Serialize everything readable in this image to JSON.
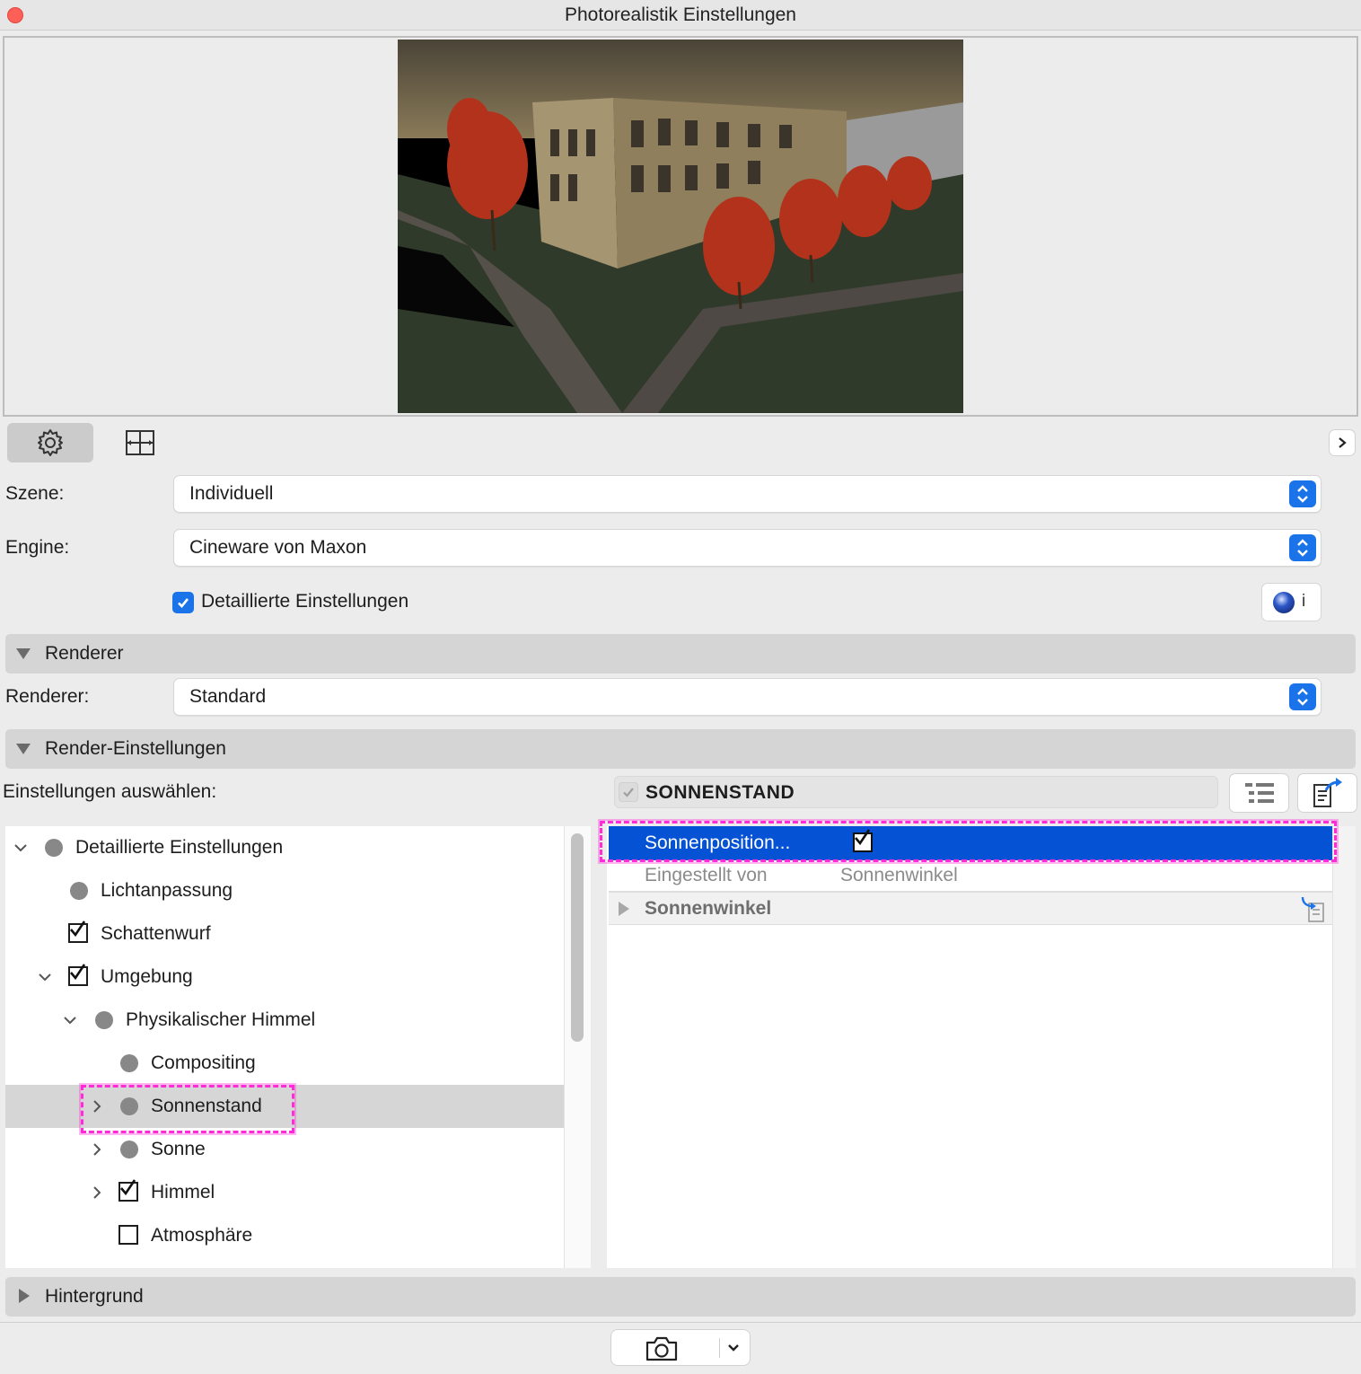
{
  "window": {
    "title": "Photorealistik Einstellungen"
  },
  "toolbar": {
    "settings_icon": "gear-icon",
    "frame_icon": "frame-size-icon",
    "expand_icon": "chevron-right-icon"
  },
  "form": {
    "szene": {
      "label": "Szene:",
      "value": "Individuell"
    },
    "engine": {
      "label": "Engine:",
      "value": "Cineware von Maxon"
    },
    "detailed": {
      "label": "Detaillierte Einstellungen",
      "checked": true
    },
    "info_button": {
      "icon": "cinema4d-logo-icon",
      "label": "i"
    }
  },
  "sections": {
    "renderer": {
      "title": "Renderer",
      "expanded": true
    },
    "render_settings": {
      "title": "Render-Einstellungen",
      "expanded": true
    },
    "hintergrund": {
      "title": "Hintergrund",
      "expanded": false
    }
  },
  "renderer_select": {
    "label": "Renderer:",
    "value": "Standard"
  },
  "settings_panel": {
    "choose_label": "Einstellungen auswählen:",
    "selected_header": "SONNENSTAND",
    "tree": [
      {
        "label": "Detaillierte Einstellungen",
        "marker": "dot",
        "expander": "expanded"
      },
      {
        "label": "Lichtanpassung",
        "marker": "dot",
        "expander": "none"
      },
      {
        "label": "Schattenwurf",
        "marker": "checkbox-checked",
        "expander": "none"
      },
      {
        "label": "Umgebung",
        "marker": "checkbox-checked",
        "expander": "expanded"
      },
      {
        "label": "Physikalischer Himmel",
        "marker": "dot",
        "expander": "expanded"
      },
      {
        "label": "Compositing",
        "marker": "dot",
        "expander": "none"
      },
      {
        "label": "Sonnenstand",
        "marker": "dot",
        "expander": "collapsed",
        "selected": true
      },
      {
        "label": "Sonne",
        "marker": "dot",
        "expander": "collapsed"
      },
      {
        "label": "Himmel",
        "marker": "checkbox-checked",
        "expander": "collapsed"
      },
      {
        "label": "Atmosphäre",
        "marker": "checkbox-unchecked",
        "expander": "none"
      }
    ],
    "properties": {
      "row1": {
        "label": "Sonnenposition...",
        "checked": true
      },
      "row2": {
        "label": "Eingestellt von",
        "value": "Sonnenwinkel"
      },
      "row3": {
        "label": "Sonnenwinkel"
      }
    }
  },
  "footer": {
    "camera_icon": "camera-icon",
    "dropdown_icon": "chevron-down-icon"
  },
  "colors": {
    "accent": "#1a73e8",
    "selection": "#0552d4",
    "highlight": "#ff2bd6"
  }
}
